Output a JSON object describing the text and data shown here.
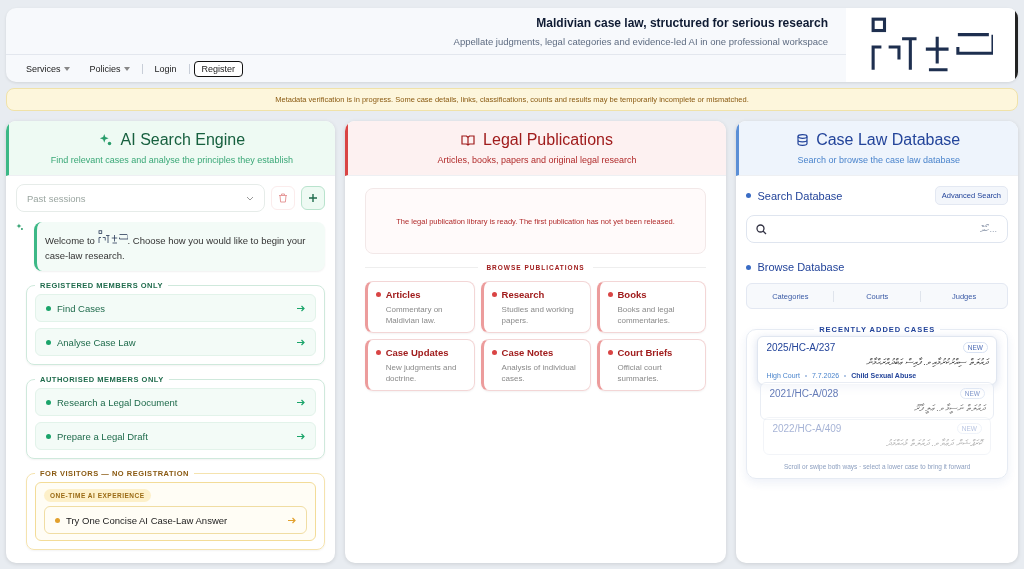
{
  "header": {
    "title": "Maldivian case law, structured for serious research",
    "subtitle": "Appellate judgments, legal categories and evidence-led AI in one professional workspace"
  },
  "nav": [
    {
      "label": "Services",
      "kind": "menu"
    },
    {
      "label": "Policies",
      "kind": "menu"
    },
    {
      "label": "Login",
      "kind": "link"
    },
    {
      "label": "Register",
      "kind": "outlined"
    }
  ],
  "notice": "Metadata verification is in progress. Some case details, links, classifications, counts and results may be temporarily incomplete or mismatched.",
  "ai_panel": {
    "title": "AI Search Engine",
    "subtitle": "Find relevant cases and analyse the principles they establish",
    "sessions": {
      "placeholder": "Past sessions"
    },
    "welcome_before": "Welcome to",
    "welcome_after": ". Choose how you would like to begin your case-law research.",
    "groups": [
      {
        "label": "REGISTERED MEMBERS ONLY",
        "kind": "members",
        "items": [
          {
            "label": "Find Cases"
          },
          {
            "label": "Analyse Case Law"
          }
        ]
      },
      {
        "label": "AUTHORISED MEMBERS ONLY",
        "kind": "members",
        "items": [
          {
            "label": "Research a Legal Document"
          },
          {
            "label": "Prepare a Legal Draft"
          }
        ]
      },
      {
        "label": "FOR VISITORS — NO REGISTRATION",
        "kind": "visitors",
        "badge": "ONE-TIME AI EXPERIENCE",
        "items": [
          {
            "label": "Try One Concise AI Case-Law Answer"
          }
        ]
      }
    ]
  },
  "publications_panel": {
    "title": "Legal Publications",
    "subtitle": "Articles, books, papers and original legal research",
    "status": "The legal publication library is ready. The first publication has not yet been released.",
    "browse_label": "BROWSE PUBLICATIONS",
    "categories": [
      {
        "title": "Articles",
        "description": "Commentary on Maldivian law."
      },
      {
        "title": "Research",
        "description": "Studies and working papers."
      },
      {
        "title": "Books",
        "description": "Books and legal commentaries."
      },
      {
        "title": "Case Updates",
        "description": "New judgments and doctrine."
      },
      {
        "title": "Case Notes",
        "description": "Analysis of individual cases."
      },
      {
        "title": "Court Briefs",
        "description": "Official court summaries."
      }
    ]
  },
  "database_panel": {
    "title": "Case Law Database",
    "subtitle": "Search or browse the case law database",
    "search_label": "Search Database",
    "advanced_button": "Advanced Search",
    "search": {
      "placeholder": "...ހޯދާ"
    },
    "browse_label": "Browse Database",
    "browse_tabs": [
      {
        "label": "Categories"
      },
      {
        "label": "Courts"
      },
      {
        "label": "Judges"
      }
    ],
    "recent_label": "RECENTLY ADDED CASES",
    "cases": [
      {
        "number": "2025/HC-A/237",
        "badge": "NEW",
        "title": "ދައުލަތް ސިއްރުކުރުމާއި ވ. ފާއިސް ޢަބްދުއްރަޙްމާން",
        "court": "High Court",
        "date": "7.7.2026",
        "category": "Child Sexual Abuse"
      },
      {
        "number": "2021/HC-A/028",
        "badge": "NEW",
        "title": "ދައުލަތް ނަސީމާ ވ. ޢަލީ ފާރޫ"
      },
      {
        "number": "2022/HC-A/409",
        "badge": "NEW",
        "title": "ކޮރަޕްޝަން ދަޢުވާ ވ. ދައުލަތް މުޙައްމަދު"
      }
    ],
    "hint": "Scroll or swipe both ways · select a lower case to bring it forward"
  }
}
